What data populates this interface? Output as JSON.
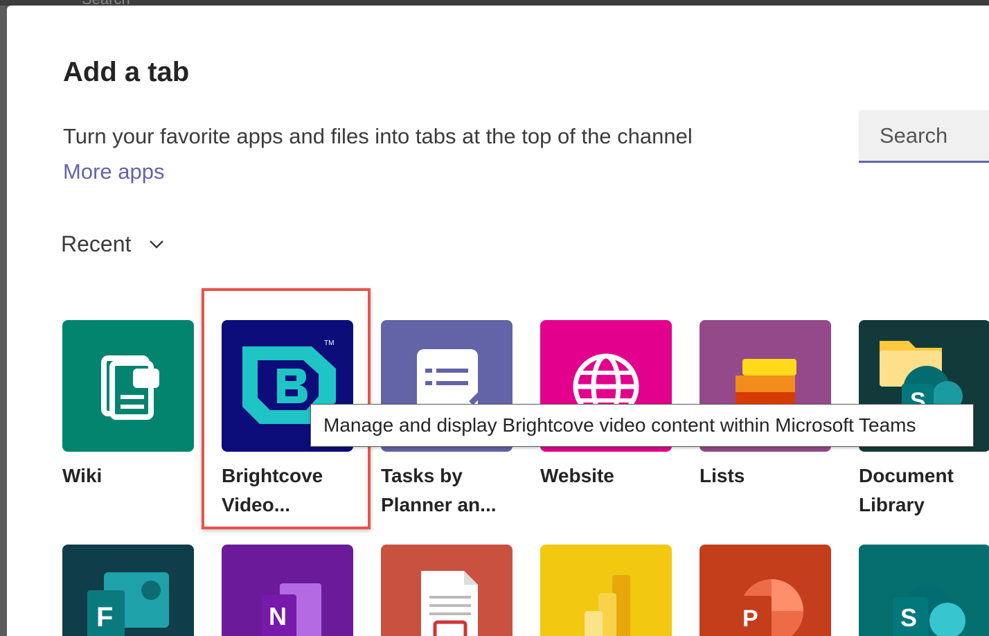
{
  "backdrop": {
    "search_text": "Search"
  },
  "dialog": {
    "title": "Add a tab",
    "description": "Turn your favorite apps and files into tabs at the top of the channel",
    "more_apps": "More apps",
    "search": {
      "placeholder": "Search",
      "value": ""
    },
    "filter": {
      "label": "Recent"
    }
  },
  "apps_row1": [
    {
      "label_line1": "Wiki",
      "label_line2": "",
      "color": "#03846f",
      "icon": "wiki-icon"
    },
    {
      "label_line1": "Brightcove",
      "label_line2": "Video...",
      "color": "#0c0c7a",
      "icon": "brightcove-icon"
    },
    {
      "label_line1": "Tasks by",
      "label_line2": "Planner an...",
      "color": "#6264a7",
      "icon": "tasks-icon"
    },
    {
      "label_line1": "Website",
      "label_line2": "",
      "color": "#e3008c",
      "icon": "globe-icon"
    },
    {
      "label_line1": "Lists",
      "label_line2": "",
      "color": "#944a8a",
      "icon": "lists-icon"
    },
    {
      "label_line1": "Document",
      "label_line2": "Library",
      "color": "#133a3a",
      "icon": "document-library-icon"
    }
  ],
  "apps_row2": [
    {
      "color": "#0f3d4a",
      "icon": "forms-icon",
      "glyph": "F"
    },
    {
      "color": "#6b1a99",
      "icon": "onenote-icon",
      "glyph": "N"
    },
    {
      "color": "#c9513f",
      "icon": "pdf-icon",
      "glyph": ""
    },
    {
      "color": "#f2c811",
      "icon": "powerbi-icon",
      "glyph": ""
    },
    {
      "color": "#c43e1c",
      "icon": "powerpoint-icon",
      "glyph": "P"
    },
    {
      "color": "#056f6f",
      "icon": "sharepoint-icon",
      "glyph": "S"
    }
  ],
  "tooltip": {
    "text": "Manage and display Brightcove video content within Microsoft Teams"
  }
}
